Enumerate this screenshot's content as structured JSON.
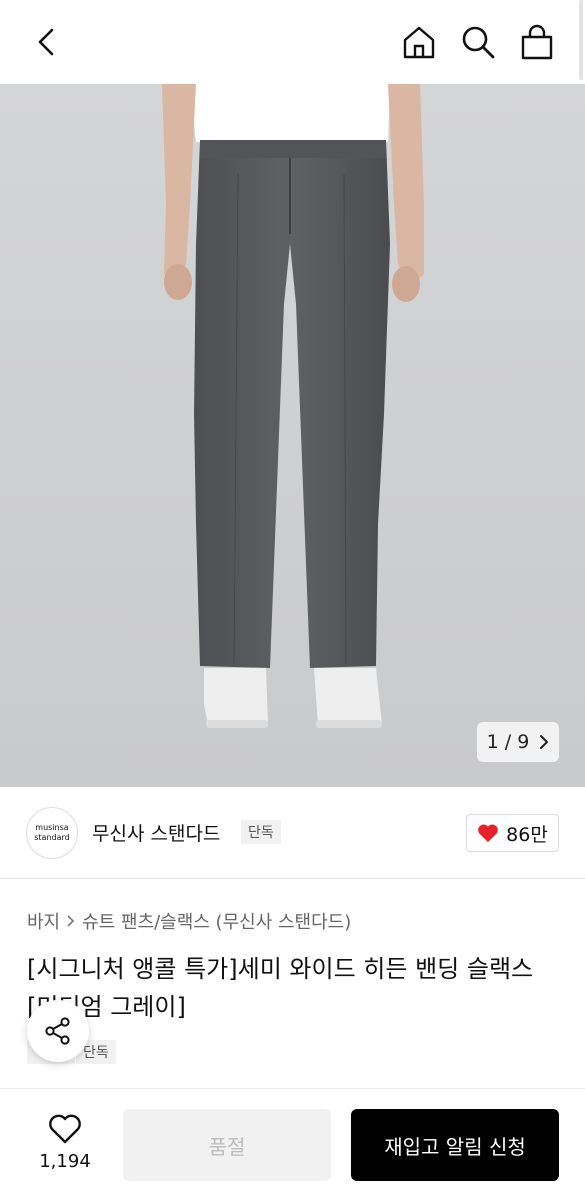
{
  "header": {
    "icons": [
      "chevron-left-icon",
      "home-icon",
      "search-icon",
      "shopping-bag-icon"
    ]
  },
  "gallery": {
    "counter": "1 / 9",
    "current": 1,
    "total": 9
  },
  "brand": {
    "logo_line1": "musinsa",
    "logo_line2": "standard",
    "name": "무신사 스탠다드",
    "badge": "단독",
    "likes": "86만",
    "heart_color": "#e8202a"
  },
  "product": {
    "breadcrumb": [
      "바지",
      "슈트 팬츠/슬랙스 (무신사 스탠다드)"
    ],
    "title": "[시그니처 앵콜 특가]세미 와이드 히든 밴딩 슬랙스 [미디엄 그레이]",
    "tag": "단독"
  },
  "bottom": {
    "wish_count": "1,194",
    "soldout_label": "품절",
    "restock_label": "재입고 알림 신청"
  }
}
